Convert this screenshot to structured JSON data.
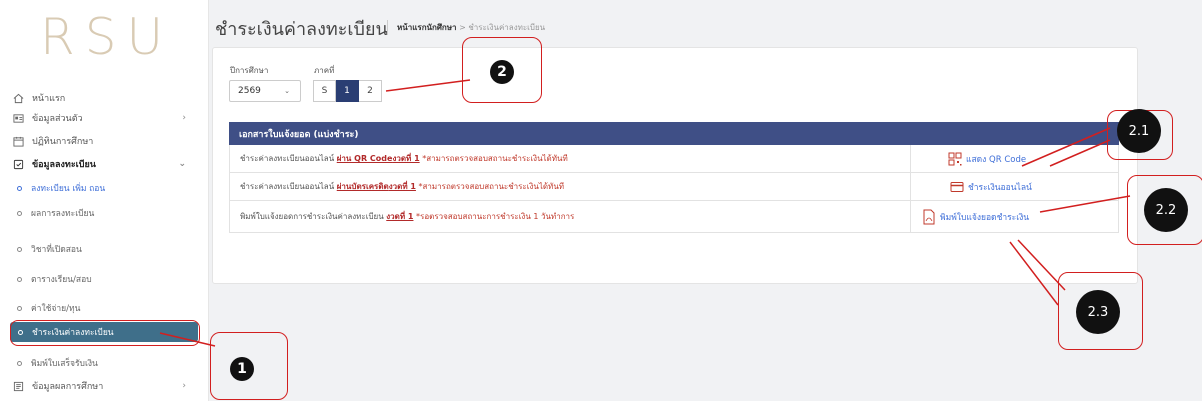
{
  "logo": "RSU",
  "sidebar": {
    "items": [
      {
        "label": "หน้าแรก",
        "icon": "home-icon"
      },
      {
        "label": "ข้อมูลส่วนตัว",
        "icon": "id-card-icon"
      },
      {
        "label": "ปฏิทินการศึกษา",
        "icon": "calendar-icon"
      },
      {
        "label": "ข้อมูลลงทะเบียน",
        "icon": "register-icon"
      }
    ],
    "sub_items": [
      "ลงทะเบียน เพิ่ม ถอน",
      "ผลการลงทะเบียน",
      "วิชาที่เปิดสอน",
      "ตารางเรียน/สอบ",
      "ค่าใช้จ่าย/ทุน",
      "ชำระเงินค่าลงทะเบียน",
      "พิมพ์ใบเสร็จรับเงิน"
    ],
    "last_item": {
      "label": "ข้อมูลผลการศึกษา",
      "icon": "grades-icon"
    }
  },
  "header": {
    "title": "ชำระเงินค่าลงทะเบียน",
    "breadcrumb_home": "หน้าแรกนักศึกษา",
    "breadcrumb_sep": ">",
    "breadcrumb_current": "ชำระเงินค่าลงทะเบียน"
  },
  "form": {
    "year_label": "ปีการศึกษา",
    "year_value": "2569",
    "term_label": "ภาคที่",
    "terms": [
      "S",
      "1",
      "2"
    ],
    "active_term": "1"
  },
  "table": {
    "header": "เอกสารใบแจ้งยอด (แบ่งชำระ)",
    "rows": [
      {
        "text": "ชำระค่าลงทะเบียนออนไลน์",
        "method": "ผ่าน QR Code",
        "installment": "งวดที่ 1",
        "note": "*สามารถตรวจสอบสถานะชำระเงินได้ทันที",
        "action": "แสดง QR Code",
        "action_icon": "qr-code-icon"
      },
      {
        "text": "ชำระค่าลงทะเบียนออนไลน์",
        "method": "ผ่านบัตรเครดิต",
        "installment": "งวดที่ 1",
        "note": "*สามารถตรวจสอบสถานะชำระเงินได้ทันที",
        "action": "ชำระเงินออนไลน์",
        "action_icon": "credit-card-icon"
      },
      {
        "text": "พิมพ์ใบแจ้งยอดการชำระเงินค่าลงทะเบียน",
        "method": "",
        "installment": "งวดที่ 1",
        "note": "*รอตรวจสอบสถานะการชำระเงิน 1 วันทำการ",
        "action": "พิมพ์ใบแจ้งยอดชำระเงิน",
        "action_icon": "pdf-icon"
      }
    ]
  },
  "annotations": {
    "badge1": "1",
    "badge2": "2",
    "badge21": "2.1",
    "badge22": "2.2",
    "badge23": "2.3",
    "color": "#d21f1f"
  },
  "colors": {
    "accent": "#3f4f86",
    "active_sidebar": "#3f6f8a",
    "link": "#3f6fd8"
  }
}
